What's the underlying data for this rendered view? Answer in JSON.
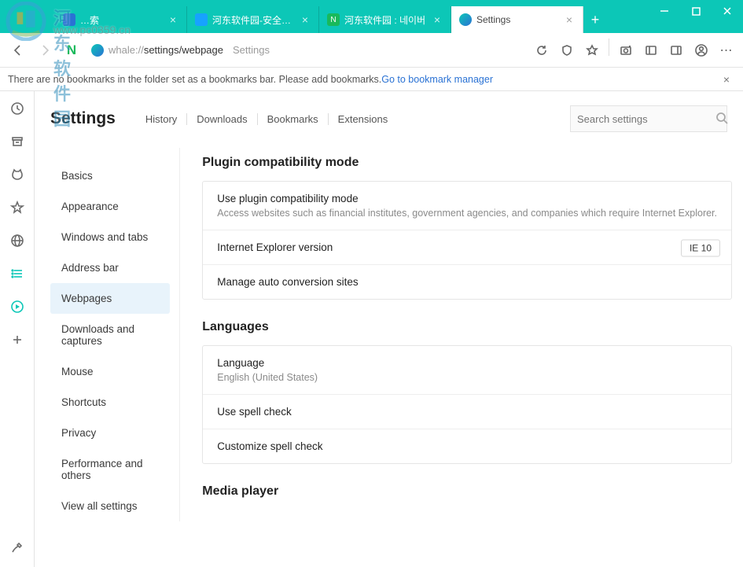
{
  "window": {
    "tabs": [
      {
        "label": "…索",
        "favicon_bg": "#2a72d4"
      },
      {
        "label": "河东软件园-安全的绿",
        "favicon_bg": "#17a2ff"
      },
      {
        "label": "河东软件园 : 네이버",
        "favicon_bg": "#19b95b"
      },
      {
        "label": "Settings",
        "favicon_bg": "#0cc7b7"
      }
    ]
  },
  "addressbar": {
    "scheme": "whale://",
    "path": "settings/webpage",
    "page_label": "Settings"
  },
  "bookmarks_notice": {
    "text": "There are no bookmarks in the folder set as a bookmarks bar. Please add bookmarks.",
    "link": "Go to bookmark manager"
  },
  "settings": {
    "title": "Settings",
    "topnav": [
      "History",
      "Downloads",
      "Bookmarks",
      "Extensions"
    ],
    "search_placeholder": "Search settings",
    "sidenav": [
      "Basics",
      "Appearance",
      "Windows and tabs",
      "Address bar",
      "Webpages",
      "Downloads and captures",
      "Mouse",
      "Shortcuts",
      "Privacy",
      "Performance and others",
      "View all settings"
    ],
    "sidenav_active_index": 4,
    "sections": {
      "plugin": {
        "heading": "Plugin compatibility mode",
        "row1_title": "Use plugin compatibility mode",
        "row1_sub": "Access websites such as financial institutes, government agencies, and companies which require Internet Explorer.",
        "row2_title": "Internet Explorer version",
        "row2_value": "IE 10",
        "row3_title": "Manage auto conversion sites"
      },
      "languages": {
        "heading": "Languages",
        "row1_title": "Language",
        "row1_sub": "English (United States)",
        "row2_title": "Use spell check",
        "row3_title": "Customize spell check"
      },
      "media": {
        "heading": "Media player"
      }
    }
  },
  "watermark": {
    "site": "河东软件园",
    "url": "www.pc0359.cn"
  }
}
